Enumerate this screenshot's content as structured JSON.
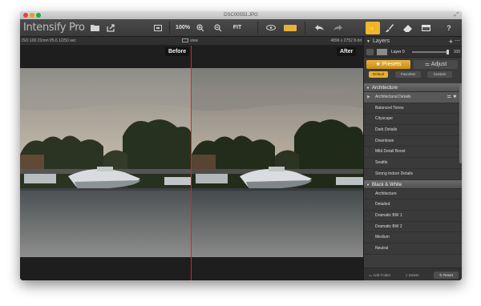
{
  "window": {
    "title": "DSC00553.JPG"
  },
  "toolbar": {
    "app_title": "Intensify Pro",
    "zoom_level": "100%",
    "fit_label": "FIT",
    "accent_color": "#f0b532"
  },
  "infobar": {
    "exif": "ISO 100    21mm    f/5.6    1/250 sec",
    "view_label": "view",
    "dimensions": "4896 x 2752     8-bit"
  },
  "compare": {
    "before_label": "Before",
    "after_label": "After",
    "split_color": "#d9232a"
  },
  "panel": {
    "layers_label": "Layers",
    "layer_name": "Layer 0",
    "layer_opacity": "100",
    "presets_tab": "Presets",
    "adjust_tab": "Adjust",
    "sub_tabs": [
      "Default",
      "Favorites",
      "Custom"
    ],
    "groups": [
      {
        "name": "Architecture",
        "items": [
          "Architectural Details",
          "Balanced Tones",
          "Cityscape",
          "Dark Details",
          "Downtown",
          "Mild Detail Boost",
          "Seattle",
          "Strong Indoor Details"
        ]
      },
      {
        "name": "Black & White",
        "items": [
          "Architecture",
          "Detailed",
          "Dramatic BW 1",
          "Dramatic BW 2",
          "Medium",
          "Neutral"
        ]
      }
    ],
    "footer": {
      "add_folder": "Add Folder",
      "delete": "Delete",
      "reset": "Reset"
    }
  }
}
